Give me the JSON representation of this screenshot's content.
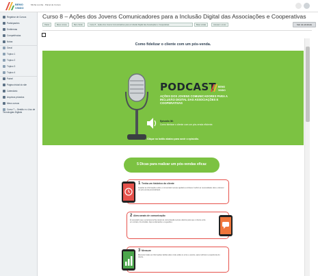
{
  "app": {
    "brand_name": "BEMO VINDO",
    "breadcrumb_top": "Minha Lomba · Painel de Cursos"
  },
  "sidebar": {
    "items": [
      {
        "label": "Registrar de Cursos",
        "icon": "hamburger-icon"
      },
      {
        "label": "Participantes",
        "icon": "users-icon"
      },
      {
        "label": "Emblemas",
        "icon": "badge-icon"
      },
      {
        "label": "Competências",
        "icon": "chart-icon"
      },
      {
        "label": "Notas",
        "icon": "grades-icon"
      },
      {
        "label": "Geral",
        "icon": "folder-icon"
      },
      {
        "label": "Tópico 1",
        "icon": "folder-icon"
      },
      {
        "label": "Tópico 2",
        "icon": "folder-icon"
      },
      {
        "label": "Tópico 3",
        "icon": "folder-icon"
      },
      {
        "label": "Tópico 4",
        "icon": "folder-icon"
      },
      {
        "label": "Painel",
        "icon": "dashboard-icon"
      },
      {
        "label": "Página inicial do site",
        "icon": "home-icon"
      },
      {
        "label": "Calendário",
        "icon": "calendar-icon"
      },
      {
        "label": "Arquivos privados",
        "icon": "file-icon"
      },
      {
        "label": "Meus cursos",
        "icon": "graduation-icon"
      },
      {
        "label": "Curso 7 – Gestão e o Uso de Tecnologias Digitais",
        "icon": "folder-icon"
      }
    ]
  },
  "header": {
    "title": "Curso 8 – Ações dos Jovens Comunicadores para a Inclusão Digital das Associações e Cooperativas",
    "crumbs": [
      "Painel",
      "Meus cursos",
      "Bem-Vindo",
      "Curso 8 – Ações dos Jovens Comunicadores para a Inclusão Digital das Associações e Cooperativas",
      "Boas vindas",
      "Acessar o curso"
    ],
    "exit_label": "Sair da atividade"
  },
  "content": {
    "intro": "Como fidelizar o cliente com um pós-venda.",
    "podcast_title": "PODCAST",
    "podcast_subtitle": "AÇÕES DOS JOVENS COMUNICADORES PARA A INCLUSÃO DIGITAL DAS ASSOCIAÇÕES E COOPERATIVAS",
    "brand_small": "BEMO VINDO",
    "episode_label": "Episódio 08:",
    "episode_text": "Como fidelizar o cliente com um pós-venda eficiente.",
    "play_cta": "Clique no botão abaixo para ouvir o episódio."
  },
  "infographic": {
    "banner": "5 Dicas para realizar um pós-vendas eficaz",
    "tips": [
      {
        "num": "1",
        "title": "Tenha um histórico do cliente",
        "body": "Guardar as informações sobre o consumidor sempre ajudará a conhecer melhor as necessidades dele e oferecer um pós-venda personalizado.",
        "icon": "clock-icon"
      },
      {
        "num": "2",
        "title": "Abra canais de comunicação",
        "body": "É necessário que a empresa tenha canais de comunicação sempre abertos para que o cliente entre em contato, tire dúvidas, faça reclamações e sugestões.",
        "icon": "chat-icon"
      },
      {
        "num": "3",
        "title": "Mensure",
        "body": "Mensurar todas as informações facilita saber onde estão os erros e acertos, para melhorar a experiência do cliente.",
        "icon": "bar-chart-icon"
      }
    ]
  },
  "colors": {
    "green": "#7cc242",
    "red": "#e6514b",
    "dark": "#1f2a2e"
  }
}
